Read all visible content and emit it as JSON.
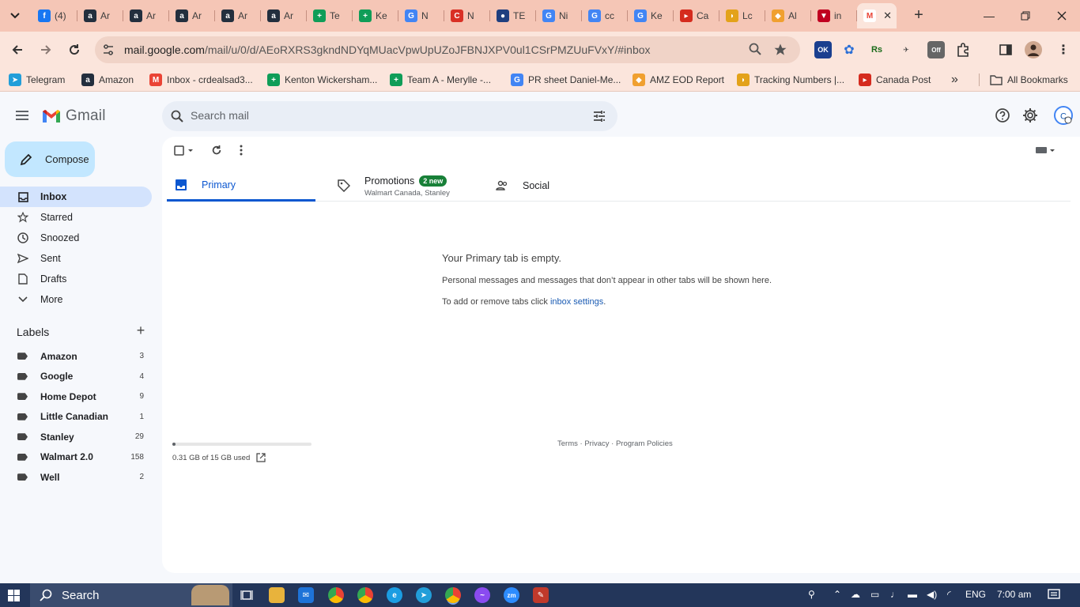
{
  "browser": {
    "tabs": [
      {
        "icon": "facebook-icon",
        "label": "(4)",
        "color": "#1877f2"
      },
      {
        "icon": "amazon-icon",
        "label": "Ar",
        "color": "#232f3e"
      },
      {
        "icon": "amazon-icon",
        "label": "Ar",
        "color": "#232f3e"
      },
      {
        "icon": "amazon-icon",
        "label": "Ar",
        "color": "#232f3e"
      },
      {
        "icon": "amazon-icon",
        "label": "Ar",
        "color": "#232f3e"
      },
      {
        "icon": "amazon-icon",
        "label": "Ar",
        "color": "#232f3e"
      },
      {
        "icon": "sheets-icon",
        "label": "Te",
        "color": "#0f9d58"
      },
      {
        "icon": "sheets-icon",
        "label": "Ke",
        "color": "#0f9d58"
      },
      {
        "icon": "google-icon",
        "label": "N",
        "color": "#4285f4"
      },
      {
        "icon": "red-c-icon",
        "label": "N",
        "color": "#d93025"
      },
      {
        "icon": "hat-icon",
        "label": "TE",
        "color": "#1f3f7f"
      },
      {
        "icon": "google-icon",
        "label": "Ni",
        "color": "#4285f4"
      },
      {
        "icon": "google-icon",
        "label": "cc",
        "color": "#4285f4"
      },
      {
        "icon": "google-icon",
        "label": "Ke",
        "color": "#4285f4"
      },
      {
        "icon": "canada-post-icon",
        "label": "Ca",
        "color": "#d52b1e"
      },
      {
        "icon": "taco-icon",
        "label": "Lc",
        "color": "#e3a21a"
      },
      {
        "icon": "amz-eod-icon",
        "label": "Al",
        "color": "#f0a030"
      },
      {
        "icon": "funnel-icon",
        "label": "in",
        "color": "#c00020"
      }
    ],
    "active_tab": {
      "icon": "gmail-icon",
      "close": "✕"
    },
    "url_host": "mail.google.com",
    "url_path": "/mail/u/0/d/AEoRXRS3gkndNDYqMUacVpwUpUZoJFBNJXPV0ul1CSrPMZUuFVxY/#inbox",
    "bookmarks": [
      {
        "icon": "telegram-icon",
        "label": "Telegram",
        "color": "#229ed9"
      },
      {
        "icon": "amazon-icon",
        "label": "Amazon",
        "color": "#232f3e"
      },
      {
        "icon": "gmail-icon",
        "label": "Inbox - crdealsad3...",
        "color": "#ea4335"
      },
      {
        "icon": "sheets-icon",
        "label": "Kenton Wickersham...",
        "color": "#0f9d58"
      },
      {
        "icon": "sheets-icon",
        "label": "Team A - Merylle -...",
        "color": "#0f9d58"
      },
      {
        "icon": "google-icon",
        "label": "PR sheet Daniel-Me...",
        "color": "#4285f4"
      },
      {
        "icon": "amz-eod-icon",
        "label": "AMZ EOD Report",
        "color": "#f0a030"
      },
      {
        "icon": "taco-icon",
        "label": "Tracking Numbers |...",
        "color": "#e3a21a"
      },
      {
        "icon": "canada-post-icon",
        "label": "Canada Post",
        "color": "#d52b1e"
      }
    ],
    "more_bookmarks": "»",
    "all_bookmarks": "All Bookmarks"
  },
  "gmail": {
    "product": "Gmail",
    "search_placeholder": "Search mail",
    "compose": "Compose",
    "nav": [
      {
        "name": "inbox",
        "label": "Inbox",
        "active": true
      },
      {
        "name": "starred",
        "label": "Starred"
      },
      {
        "name": "snoozed",
        "label": "Snoozed"
      },
      {
        "name": "sent",
        "label": "Sent"
      },
      {
        "name": "drafts",
        "label": "Drafts"
      },
      {
        "name": "more",
        "label": "More"
      }
    ],
    "labels_title": "Labels",
    "labels_add": "+",
    "labels": [
      {
        "name": "Amazon",
        "count": "3"
      },
      {
        "name": "Google",
        "count": "4"
      },
      {
        "name": "Home Depot",
        "count": "9"
      },
      {
        "name": "Little Canadian",
        "count": "1"
      },
      {
        "name": "Stanley",
        "count": "29"
      },
      {
        "name": "Walmart 2.0",
        "count": "158"
      },
      {
        "name": "Well",
        "count": "2"
      }
    ],
    "tabs": {
      "primary": "Primary",
      "promotions": "Promotions",
      "promotions_badge": "2 new",
      "promotions_sub": "Walmart Canada, Stanley",
      "social": "Social"
    },
    "empty": {
      "title": "Your Primary tab is empty.",
      "line1": "Personal messages and messages that don’t appear in other tabs will be shown here.",
      "line2_prefix": "To add or remove tabs click ",
      "line2_link": "inbox settings",
      "line2_suffix": "."
    },
    "storage": {
      "text": "0.31 GB of 15 GB used",
      "fraction": 0.02
    },
    "footer": {
      "terms": "Terms",
      "sep1": " · ",
      "privacy": "Privacy",
      "sep2": " · ",
      "policies": "Program Policies"
    }
  },
  "taskbar": {
    "search": "Search",
    "language": "ENG",
    "time": "7:00 am"
  }
}
